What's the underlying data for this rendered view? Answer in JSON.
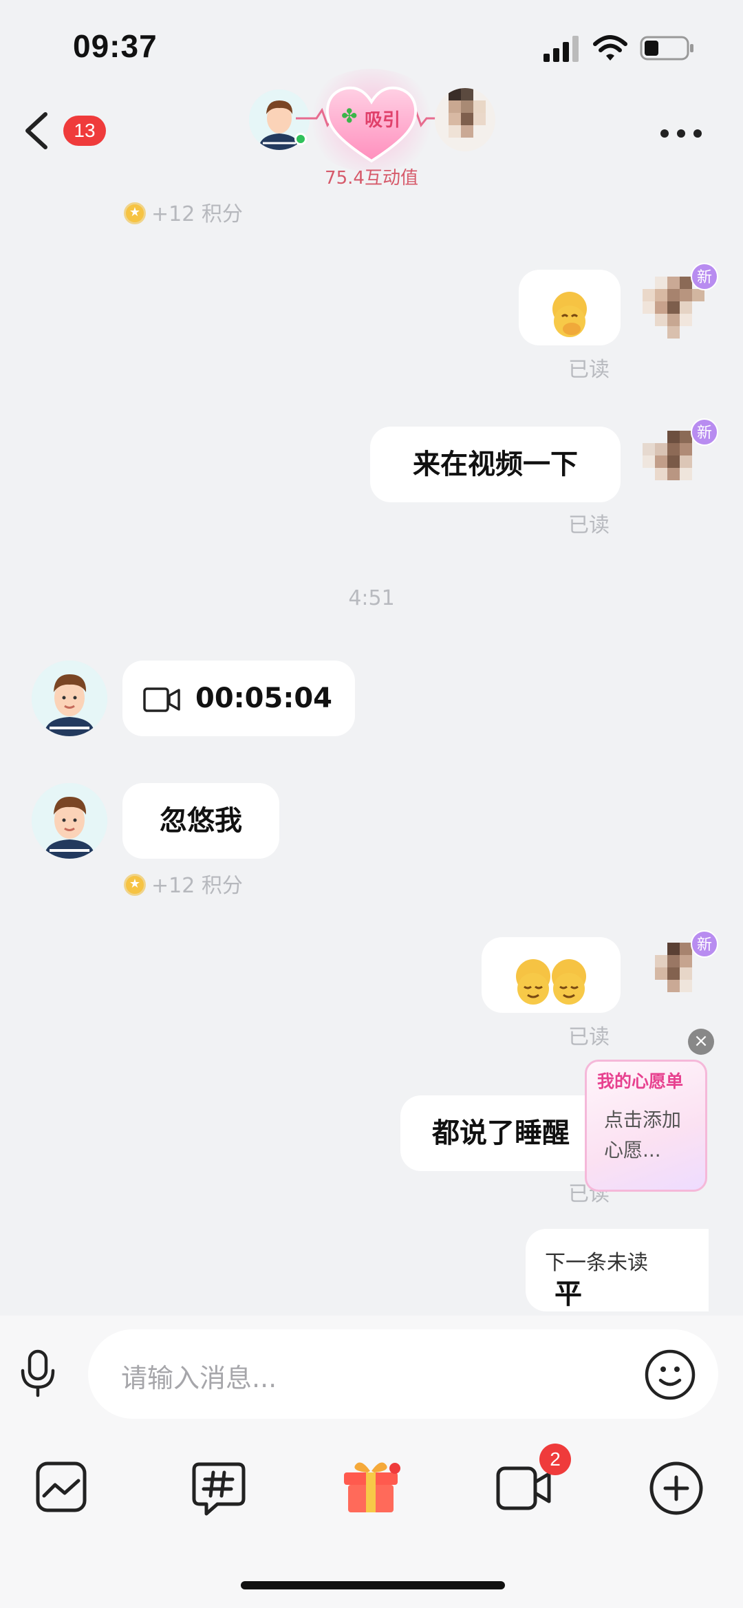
{
  "status_bar": {
    "time": "09:37"
  },
  "header": {
    "unread_count": "13",
    "relationship_label": "吸引",
    "interaction_score": "75.4互动值"
  },
  "chat": {
    "points_top": "+12 积分",
    "msg1": {
      "emoji": "hand-over-mouth-emoji",
      "read": "已读",
      "badge": "新"
    },
    "msg2": {
      "text": "来在视频一下",
      "read": "已读",
      "badge": "新"
    },
    "timestamp": "4:51",
    "call": {
      "duration": "00:05:04"
    },
    "msg3": {
      "text": "忽悠我",
      "points": "+12 积分"
    },
    "msg4": {
      "emoji": "relieved-face-emoji",
      "read": "已读",
      "badge": "新"
    },
    "msg5": {
      "text": "都说了睡醒",
      "read": "已读"
    },
    "next_unread": "下一条未读",
    "next_partial": "平"
  },
  "wish_card": {
    "title": "我的心愿单",
    "body_line1": "点击添加",
    "body_line2": "心愿..."
  },
  "input": {
    "placeholder": "请输入消息..."
  },
  "toolbar": {
    "video_badge": "2"
  },
  "colors": {
    "accent_red": "#ef3b3b",
    "new_badge": "#b88cf0",
    "score_text": "#d65a6a"
  }
}
